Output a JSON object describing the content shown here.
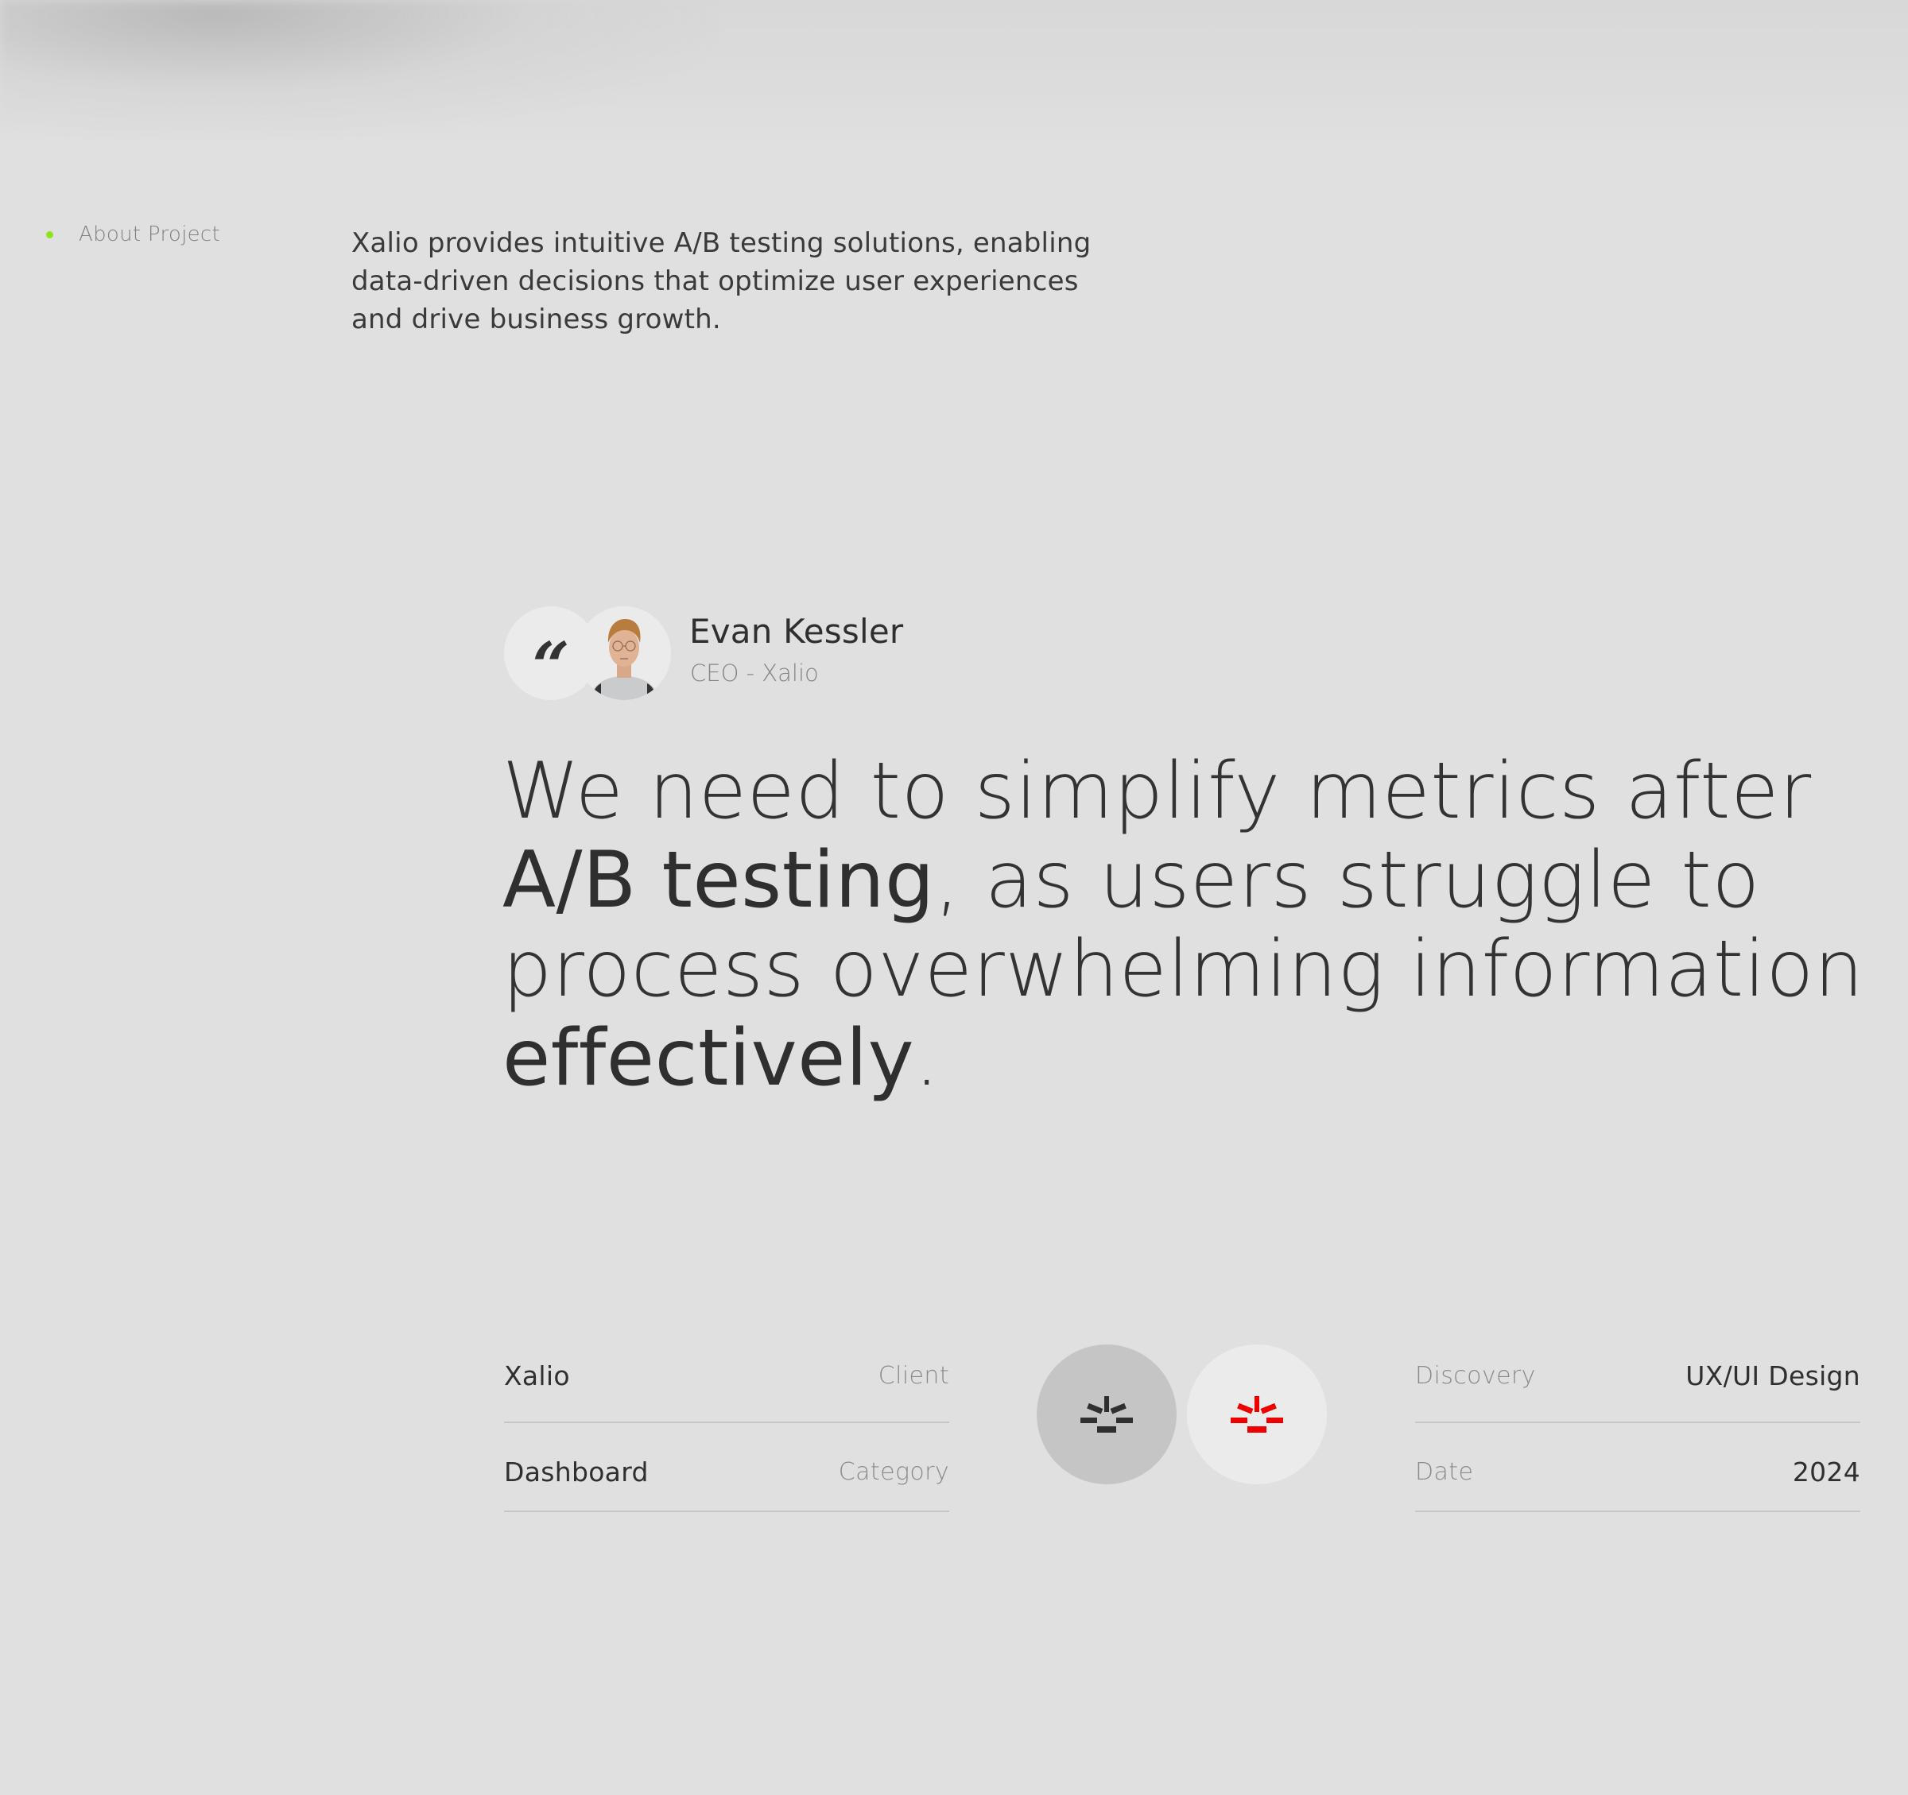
{
  "about": {
    "label": "About Project",
    "dot_color": "#8fe31a",
    "description": "Xalio provides intuitive A/B testing solutions, enabling data-driven decisions that optimize user experiences and drive business growth."
  },
  "testimonial": {
    "quote_icon": "quote-open-icon",
    "quote_glyph": "“",
    "author": {
      "name": "Evan Kessler",
      "role": "CEO - Xalio",
      "avatar": "avatar-photo"
    },
    "quote_segments": [
      {
        "text": "We need to simplify metrics after ",
        "emphasis": false
      },
      {
        "text": "A/B testing",
        "emphasis": true
      },
      {
        "text": ", as users struggle to process overwhelming information ",
        "emphasis": false
      },
      {
        "text": "effectively",
        "emphasis": true
      },
      {
        "text": ".",
        "emphasis": false
      }
    ]
  },
  "details": {
    "left": [
      {
        "value": "Xalio",
        "key": "Client"
      },
      {
        "value": "Dashboard",
        "key": "Category"
      }
    ],
    "right": [
      {
        "key": "Discovery",
        "value": "UX/UI Design"
      },
      {
        "key": "Date",
        "value": "2024"
      }
    ]
  },
  "logos": [
    {
      "name": "xalio-logo-dark",
      "icon": "sunrise-bars-icon",
      "color": "#2f2f2f"
    },
    {
      "name": "xalio-logo-red",
      "icon": "sunrise-bars-icon",
      "color": "#ee0000"
    }
  ]
}
